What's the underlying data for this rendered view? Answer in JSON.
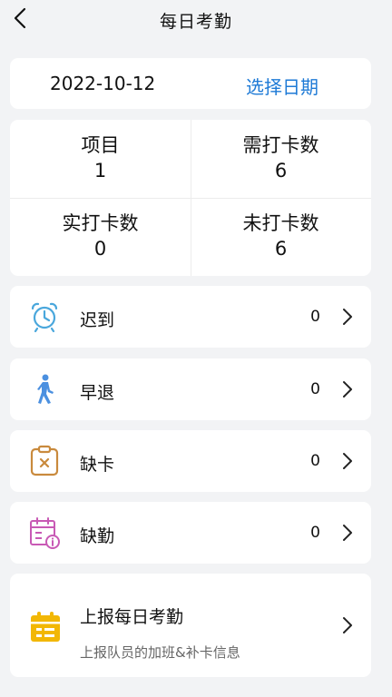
{
  "header": {
    "title": "每日考勤"
  },
  "date_bar": {
    "date": "2022-10-12",
    "select_label": "选择日期"
  },
  "stats": [
    {
      "label": "项目",
      "value": "1"
    },
    {
      "label": "需打卡数",
      "value": "6"
    },
    {
      "label": "实打卡数",
      "value": "0"
    },
    {
      "label": "未打卡数",
      "value": "6"
    }
  ],
  "rows": [
    {
      "label": "迟到",
      "count": "0",
      "icon": "alarm-clock-icon",
      "color": "#4aa7dc"
    },
    {
      "label": "早退",
      "count": "0",
      "icon": "walking-person-icon",
      "color": "#4b90e0"
    },
    {
      "label": "缺卡",
      "count": "0",
      "icon": "clipboard-x-icon",
      "color": "#c98a3d"
    },
    {
      "label": "缺勤",
      "count": "0",
      "icon": "calendar-info-icon",
      "color": "#c85ab5"
    }
  ],
  "report": {
    "title": "上报每日考勤",
    "subtitle": "上报队员的加班&补卡信息",
    "icon": "calendar-report-icon",
    "color": "#f2b705"
  }
}
